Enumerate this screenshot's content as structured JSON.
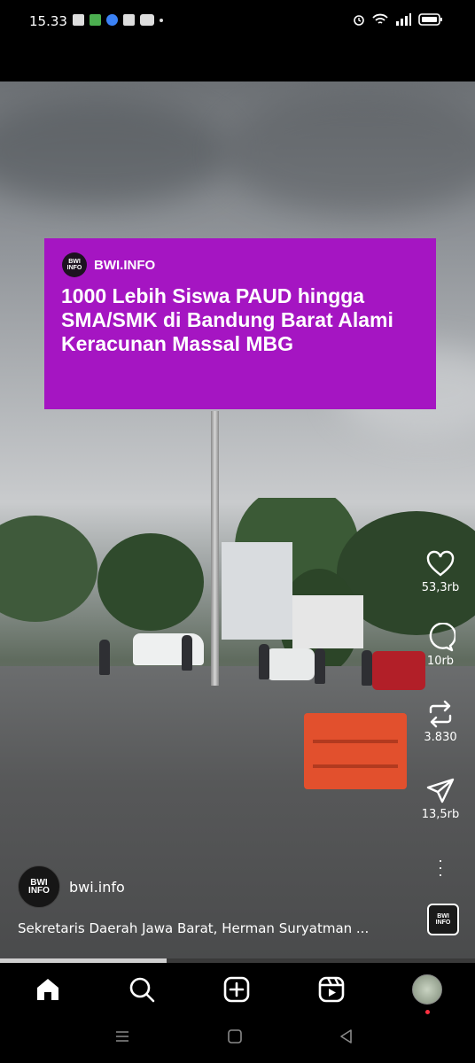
{
  "status_bar": {
    "time": "15.33",
    "left_icons": [
      "facebook-icon",
      "chat-app-icon",
      "browser-icon",
      "facebook-icon",
      "youtube-icon",
      "dot-icon"
    ],
    "right_icons": [
      "alarm-icon",
      "wifi-icon",
      "signal-icon",
      "battery-icon"
    ]
  },
  "video": {
    "overlay": {
      "brand": "BWI.INFO",
      "brand_logo_text": "BWI INFO",
      "headline": "1000 Lebih Siswa PAUD hingga SMA/SMK di Bandung Barat Alami Keracunan Massal MBG",
      "background": "#a515c2"
    },
    "barrier_color": "#e2502d"
  },
  "actions": {
    "like": {
      "icon": "heart-icon",
      "count": "53,3rb"
    },
    "comment": {
      "icon": "comment-icon",
      "count": "10rb"
    },
    "repost": {
      "icon": "repost-icon",
      "count": "3.830"
    },
    "share": {
      "icon": "send-icon",
      "count": "13,5rb"
    },
    "more": {
      "icon": "more-vertical-icon"
    }
  },
  "post": {
    "avatar_text": "BWI INFO",
    "username": "bwi.info",
    "caption": "Sekretaris Daerah Jawa Barat, Herman Suryatman ...",
    "audio_thumb_text": "BWI INFO"
  },
  "progress": {
    "fraction": 0.35
  },
  "bottom_nav": {
    "items": [
      "home-icon",
      "search-icon",
      "create-icon",
      "reels-icon",
      "profile-avatar"
    ]
  },
  "system_nav": [
    "menu-icon",
    "home-square-icon",
    "back-icon"
  ]
}
